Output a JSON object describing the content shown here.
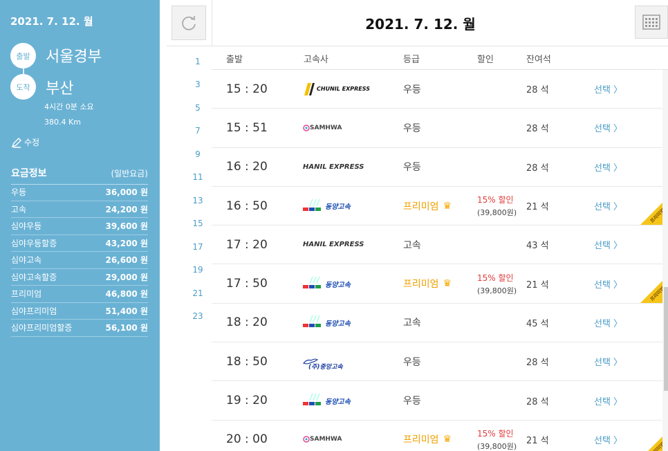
{
  "sidebar": {
    "date": "2021. 7. 12. 월",
    "departure_badge": "출발",
    "departure": "서울경부",
    "arrival_badge": "도착",
    "arrival": "부산",
    "duration": "4시간 0분 소요",
    "distance": "380.4 Km",
    "edit_label": "수정",
    "fare_title": "요금정보",
    "fare_sub": "(일반요금)",
    "fares": [
      {
        "name": "우등",
        "price": "36,000 원"
      },
      {
        "name": "고속",
        "price": "24,200 원"
      },
      {
        "name": "심야우등",
        "price": "39,600 원"
      },
      {
        "name": "심야우등할증",
        "price": "43,200 원"
      },
      {
        "name": "심야고속",
        "price": "26,600 원"
      },
      {
        "name": "심야고속할증",
        "price": "29,000 원"
      },
      {
        "name": "프리미엄",
        "price": "46,800 원"
      },
      {
        "name": "심야프리미엄",
        "price": "51,400 원"
      },
      {
        "name": "심야프리미엄할증",
        "price": "56,100 원"
      }
    ]
  },
  "header": {
    "date": "2021. 7. 12. 월"
  },
  "hours": [
    "1",
    "3",
    "5",
    "7",
    "9",
    "11",
    "13",
    "15",
    "17",
    "19",
    "21",
    "23"
  ],
  "columns": {
    "departure": "출발",
    "company": "고속사",
    "grade": "등급",
    "discount": "할인",
    "seats": "잔여석"
  },
  "rows": [
    {
      "time": "15 : 20",
      "company": "CHUNIL EXPRESS",
      "grade": "우등",
      "premium": false,
      "discount": "",
      "discount_price": "",
      "seats": "28 석",
      "select": "선택 〉"
    },
    {
      "time": "15 : 51",
      "company": "SAMHWA",
      "grade": "우등",
      "premium": false,
      "discount": "",
      "discount_price": "",
      "seats": "28 석",
      "select": "선택 〉"
    },
    {
      "time": "16 : 20",
      "company": "HANIL EXPRESS",
      "grade": "우등",
      "premium": false,
      "discount": "",
      "discount_price": "",
      "seats": "28 석",
      "select": "선택 〉"
    },
    {
      "time": "16 : 50",
      "company": "동양고속",
      "grade": "프리미엄",
      "premium": true,
      "discount": "15% 할인",
      "discount_price": "(39,800원)",
      "seats": "21 석",
      "select": "선택 〉"
    },
    {
      "time": "17 : 20",
      "company": "HANIL EXPRESS",
      "grade": "고속",
      "premium": false,
      "discount": "",
      "discount_price": "",
      "seats": "43 석",
      "select": "선택 〉"
    },
    {
      "time": "17 : 50",
      "company": "동양고속",
      "grade": "프리미엄",
      "premium": true,
      "discount": "15% 할인",
      "discount_price": "(39,800원)",
      "seats": "21 석",
      "select": "선택 〉"
    },
    {
      "time": "18 : 20",
      "company": "동양고속",
      "grade": "고속",
      "premium": false,
      "discount": "",
      "discount_price": "",
      "seats": "45 석",
      "select": "선택 〉"
    },
    {
      "time": "18 : 50",
      "company": "(주)중앙고속",
      "grade": "우등",
      "premium": false,
      "discount": "",
      "discount_price": "",
      "seats": "28 석",
      "select": "선택 〉"
    },
    {
      "time": "19 : 20",
      "company": "동양고속",
      "grade": "우등",
      "premium": false,
      "discount": "",
      "discount_price": "",
      "seats": "28 석",
      "select": "선택 〉"
    },
    {
      "time": "20 : 00",
      "company": "SAMHWA",
      "grade": "프리미엄",
      "premium": true,
      "discount": "15% 할인",
      "discount_price": "(39,800원)",
      "seats": "21 석",
      "select": "선택 〉"
    }
  ],
  "premium_tag": "프리미엄",
  "colors": {
    "sidebar_bg": "#6ab2d4",
    "accent_blue": "#4a9cc7",
    "premium_orange": "#f0a000",
    "discount_red": "#e23b3b"
  }
}
